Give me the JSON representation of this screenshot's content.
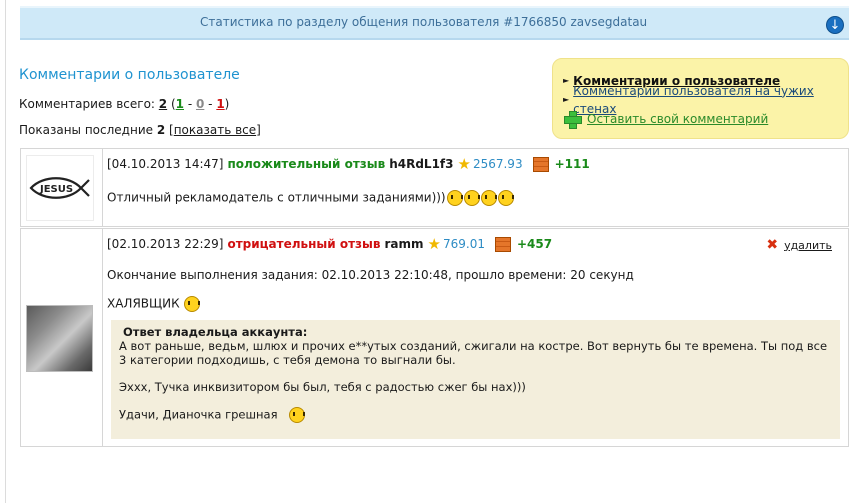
{
  "stat_bar": {
    "title": "Статистика по разделу общения пользователя #1766850 zavsegdatau",
    "icon": "chevron-down-circle-icon"
  },
  "section_title": "Комментарии о пользователе",
  "summary": {
    "total_label": "Комментариев всего:",
    "total": "2",
    "positive": "1",
    "neutral": "0",
    "negative": "1",
    "shown_label": "Показаны последние",
    "shown_count": "2",
    "show_all": "показать все"
  },
  "sidebar": {
    "items": [
      {
        "label": "Комментарии о пользователе"
      },
      {
        "label": "Комментарии пользователя на чужих стенах"
      },
      {
        "label": "Оставить свой комментарий"
      }
    ]
  },
  "comments": [
    {
      "date": "[04.10.2013 14:47]",
      "type": "положительный отзыв",
      "user": "h4RdL1f3",
      "rating": "2567.93",
      "score": "+111",
      "text": "Отличный рекламодатель с отличными заданиями)))",
      "avatar_text": "JESUS"
    },
    {
      "date": "[02.10.2013 22:29]",
      "type": "отрицательный отзыв",
      "user": "ramm",
      "rating": "769.01",
      "score": "+457",
      "delete": "удалить",
      "line1": "Окончание выполнения задания: 02.10.2013 22:10:48, прошло времени: 20 секунд",
      "line2": "ХАЛЯВЩИК",
      "reply": {
        "title": "Ответ владельца аккаунта:",
        "p1": "А вот раньше, ведьм, шлюх и прочих е**утых созданий, сжигали на костре. Вот вернуть бы те времена. Ты под все 3 категории подходишь, с тебя демона то выгнали бы.",
        "p2": "Эххх, Тучка инквизитором бы был, тебя с радостью сжег бы нах)))",
        "p3": "Удачи, Дианочка грешная"
      }
    }
  ],
  "colors": {
    "accent": "#1f93d0",
    "positive": "#1a8a1a",
    "negative": "#d01010",
    "sidebox": "#fbf3a8"
  }
}
